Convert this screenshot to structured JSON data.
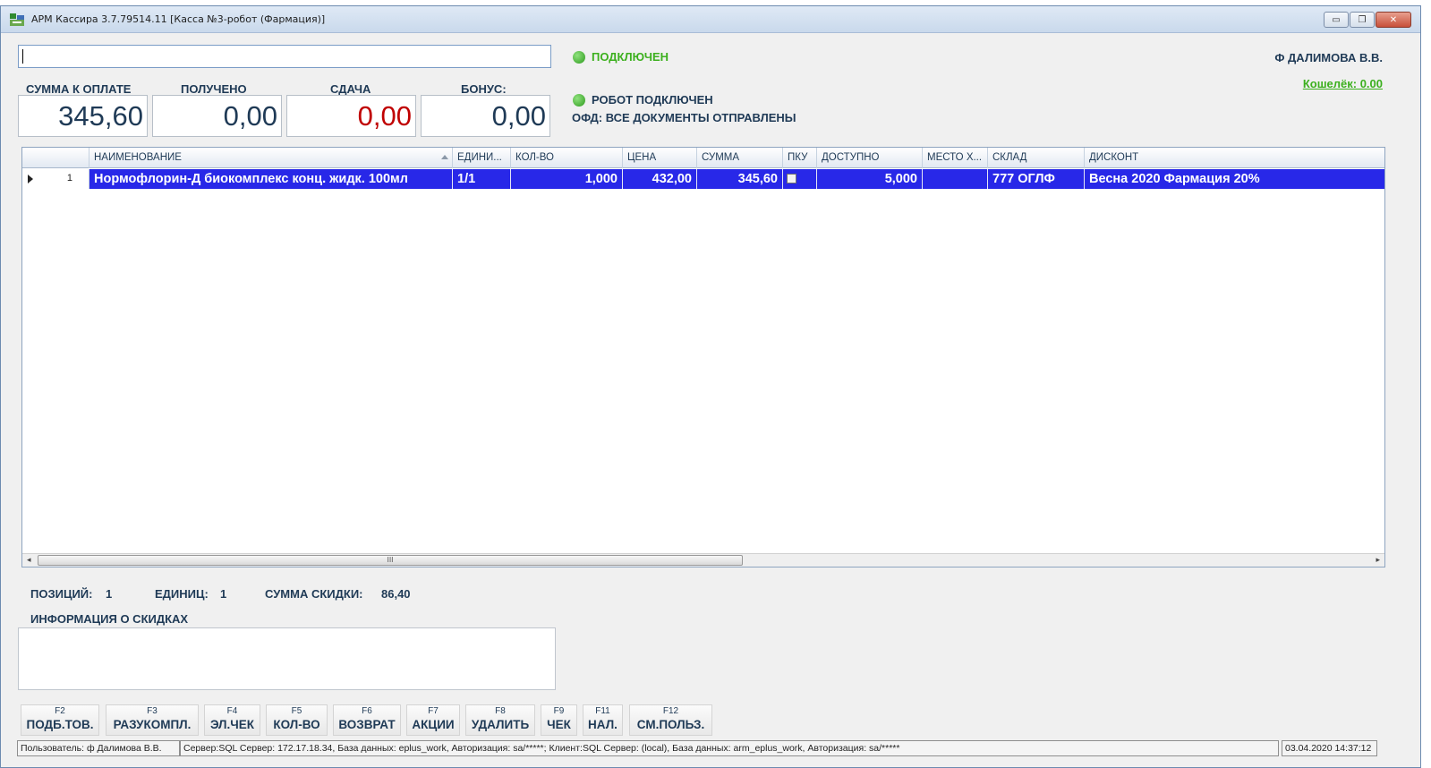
{
  "window": {
    "title": "АРМ Кассира 3.7.79514.11 [Касса №3-робот (Фармация)]",
    "controls": {
      "minimize": "▭",
      "maximize": "❐",
      "close": "✕"
    }
  },
  "search": {
    "value": ""
  },
  "status": {
    "connected": "ПОДКЛЮЧЕН",
    "robot": "РОБОТ ПОДКЛЮЧЕН",
    "ofd": "ОФД: ВСЕ ДОКУМЕНТЫ ОТПРАВЛЕНЫ",
    "connected_color": "#3cb01e",
    "robot_color": "#1f3a56"
  },
  "user": {
    "name": "Ф ДАЛИМОВА В.В.",
    "wallet": "Кошелёк: 0.00"
  },
  "totals": {
    "to_pay_label": "СУММА К ОПЛАТЕ",
    "to_pay_value": "345,60",
    "received_label": "ПОЛУЧЕНО",
    "received_value": "0,00",
    "change_label": "СДАЧА",
    "change_value": "0,00",
    "change_color": "#c00000",
    "bonus_label": "БОНУС:",
    "bonus_value": "0,00"
  },
  "grid": {
    "columns": [
      "НАИМЕНОВАНИЕ",
      "ЕДИНИ...",
      "КОЛ-ВО",
      "ЦЕНА",
      "СУММА",
      "ПКУ",
      "ДОСТУПНО",
      "МЕСТО Х...",
      "СКЛАД",
      "ДИСКОНТ"
    ],
    "rows": [
      {
        "num": "1",
        "name": "Нормофлорин-Д биокомплекс конц. жидк. 100мл",
        "unit": "1/1",
        "qty": "1,000",
        "price": "432,00",
        "sum": "345,60",
        "pku": false,
        "available": "5,000",
        "place": "",
        "warehouse": "777 ОГЛФ",
        "discount": "Весна 2020 Фармация 20%"
      }
    ],
    "selected_row_color": "#2828e8",
    "scroll_thumb": "III"
  },
  "summary": {
    "positions_label": "ПОЗИЦИЙ:",
    "positions_value": "1",
    "units_label": "ЕДИНИЦ:",
    "units_value": "1",
    "discount_sum_label": "СУММА СКИДКИ:",
    "discount_sum_value": "86,40",
    "discount_info_title": "ИНФОРМАЦИЯ О СКИДКАХ"
  },
  "fkeys": [
    {
      "code": "F2",
      "label": "ПОДБ.ТОВ."
    },
    {
      "code": "F3",
      "label": "РАЗУКОМПЛ."
    },
    {
      "code": "F4",
      "label": "ЭЛ.ЧЕК"
    },
    {
      "code": "F5",
      "label": "КОЛ-ВО"
    },
    {
      "code": "F6",
      "label": "ВОЗВРАТ"
    },
    {
      "code": "F7",
      "label": "АКЦИИ"
    },
    {
      "code": "F8",
      "label": "УДАЛИТЬ"
    },
    {
      "code": "F9",
      "label": "ЧЕК"
    },
    {
      "code": "F11",
      "label": "НАЛ."
    },
    {
      "code": "F12",
      "label": "СМ.ПОЛЬЗ."
    }
  ],
  "statusbar": {
    "user": "Пользователь: ф Далимова В.В.",
    "server": "Сервер:SQL Сервер: 172.17.18.34,  База данных: eplus_work,  Авторизация: sa/*****;     Клиент:SQL Сервер: (local),  База данных: arm_eplus_work,  Авторизация: sa/*****",
    "datetime": "03.04.2020 14:37:12"
  }
}
